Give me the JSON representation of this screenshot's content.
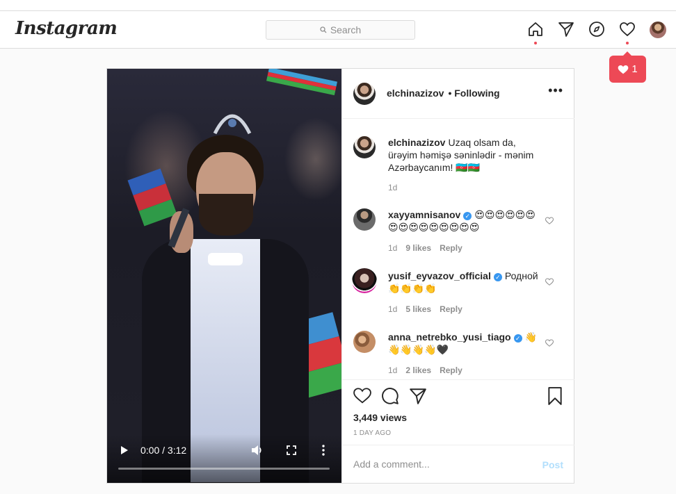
{
  "nav": {
    "logo": "Instagram",
    "search_placeholder": "Search",
    "icons": [
      "home-icon",
      "direct-icon",
      "explore-icon",
      "activity-heart-icon",
      "profile-avatar"
    ]
  },
  "notification": {
    "count": "1"
  },
  "post": {
    "author": "elchinazizov",
    "follow_status": "• Following",
    "caption": "Uzaq olsam da, ürəyim həmişə səninlədir - mənim Azərbaycanım! 🇦🇿🇦🇿",
    "caption_time": "1d",
    "video": {
      "timecode": "0:00 / 3:12"
    },
    "comments": [
      {
        "user": "xayyamnisanov",
        "verified": true,
        "text": "😍😍😍😍😍😍😍😍😍😍😍😍😍😍😍",
        "time": "1d",
        "likes": "9 likes",
        "reply": "Reply"
      },
      {
        "user": "yusif_eyvazov_official",
        "verified": true,
        "text": "Родной 👏👏👏👏",
        "time": "1d",
        "likes": "5 likes",
        "reply": "Reply"
      },
      {
        "user": "anna_netrebko_yusi_tiago",
        "verified": true,
        "text": "👋 👋👋👋👋🖤",
        "time": "1d",
        "likes": "2 likes",
        "reply": "Reply"
      }
    ],
    "views": "3,449 views",
    "posted_ago": "1 DAY AGO",
    "add_comment_placeholder": "Add a comment...",
    "post_button": "Post"
  },
  "colors": {
    "accent_red": "#ed4956",
    "link_blue": "#3897f0",
    "post_disabled": "#b2dffc",
    "border": "#dbdbdb"
  }
}
